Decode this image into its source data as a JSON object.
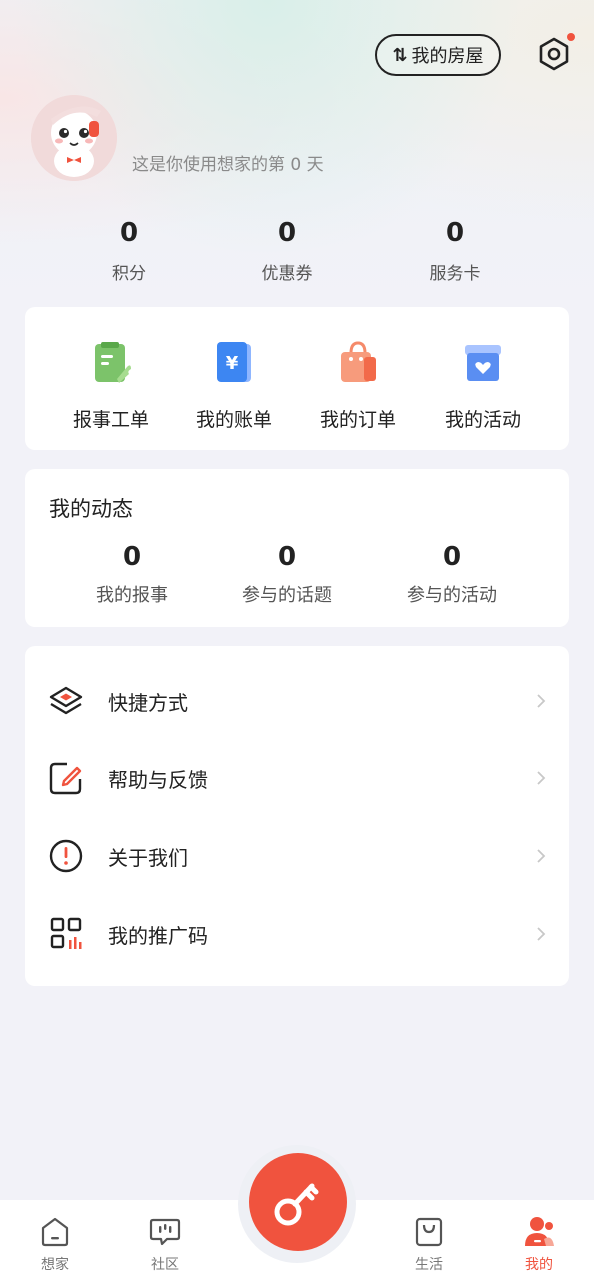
{
  "header": {
    "house_button_icon": "swap-icon",
    "house_button_label": "我的房屋",
    "settings_icon": "hexagon-settings-icon"
  },
  "profile": {
    "days_text": "这是你使用想家的第 0 天"
  },
  "stats": [
    {
      "value": "0",
      "label": "积分"
    },
    {
      "value": "0",
      "label": "优惠券"
    },
    {
      "value": "0",
      "label": "服务卡"
    }
  ],
  "quick_actions": [
    {
      "label": "报事工单",
      "icon": "repair-order-icon"
    },
    {
      "label": "我的账单",
      "icon": "bill-icon"
    },
    {
      "label": "我的订单",
      "icon": "shopping-bag-icon"
    },
    {
      "label": "我的活动",
      "icon": "activity-box-icon"
    }
  ],
  "dynamics": {
    "title": "我的动态",
    "items": [
      {
        "value": "0",
        "label": "我的报事"
      },
      {
        "value": "0",
        "label": "参与的话题"
      },
      {
        "value": "0",
        "label": "参与的活动"
      }
    ]
  },
  "menu": [
    {
      "label": "快捷方式",
      "icon": "layers-icon"
    },
    {
      "label": "帮助与反馈",
      "icon": "edit-icon"
    },
    {
      "label": "关于我们",
      "icon": "info-icon"
    },
    {
      "label": "我的推广码",
      "icon": "qrcode-icon"
    }
  ],
  "tabs": [
    {
      "label": "想家",
      "icon": "home-icon"
    },
    {
      "label": "社区",
      "icon": "chat-icon"
    },
    {
      "label": "生活",
      "icon": "bag-icon"
    },
    {
      "label": "我的",
      "icon": "profile-icon",
      "active": true
    }
  ],
  "center_button_icon": "key-icon",
  "colors": {
    "accent": "#f0533e",
    "background": "#f2f2f8"
  }
}
